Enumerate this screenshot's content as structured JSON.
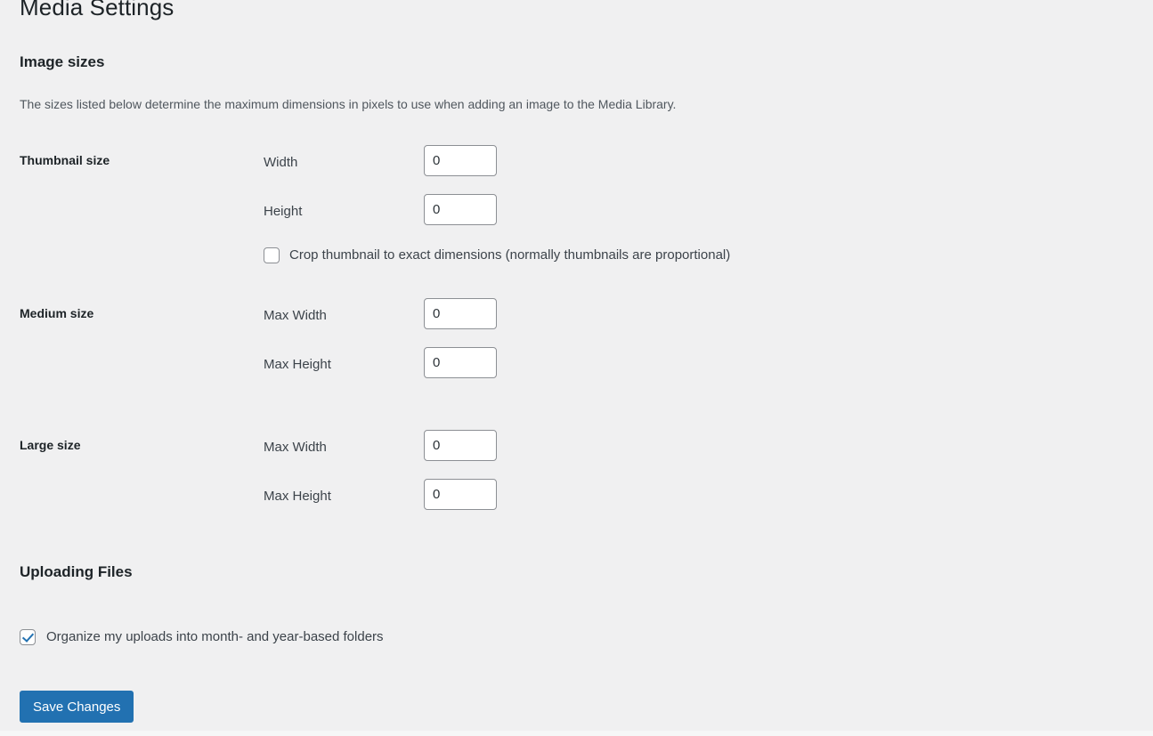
{
  "page": {
    "title": "Media Settings"
  },
  "image_sizes": {
    "heading": "Image sizes",
    "description": "The sizes listed below determine the maximum dimensions in pixels to use when adding an image to the Media Library.",
    "rows": [
      {
        "label": "Thumbnail size",
        "fields": [
          {
            "label": "Width",
            "value": "0"
          },
          {
            "label": "Height",
            "value": "0"
          }
        ],
        "checkbox": {
          "label": "Crop thumbnail to exact dimensions (normally thumbnails are proportional)",
          "checked": false
        }
      },
      {
        "label": "Medium size",
        "fields": [
          {
            "label": "Max Width",
            "value": "0"
          },
          {
            "label": "Max Height",
            "value": "0"
          }
        ]
      },
      {
        "label": "Large size",
        "fields": [
          {
            "label": "Max Width",
            "value": "0"
          },
          {
            "label": "Max Height",
            "value": "0"
          }
        ]
      }
    ]
  },
  "uploading_files": {
    "heading": "Uploading Files",
    "organize_uploads": {
      "label": "Organize my uploads into month- and year-based folders",
      "checked": true
    }
  },
  "actions": {
    "save_label": "Save Changes"
  },
  "colors": {
    "accent": "#2271b1",
    "background": "#f0f0f1",
    "heading_text": "#1d2327",
    "body_text": "#3c434a"
  }
}
